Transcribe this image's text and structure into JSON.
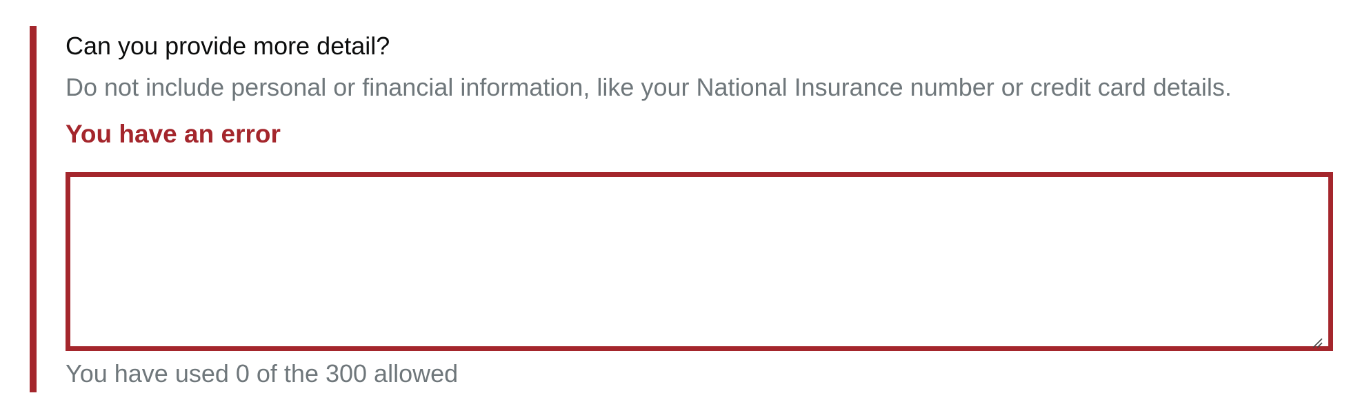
{
  "form": {
    "question": "Can you provide more detail?",
    "hint": "Do not include personal or financial information, like your National Insurance number or credit card details.",
    "error_message": "You have an error",
    "textarea": {
      "value": "",
      "placeholder": ""
    },
    "counter": "You have used 0 of the 300 allowed"
  },
  "colors": {
    "error": "#a4262c",
    "hint": "#6f777b",
    "text": "#0b0c0c"
  },
  "icons": {
    "resize_handle": "resize-grip-icon"
  }
}
